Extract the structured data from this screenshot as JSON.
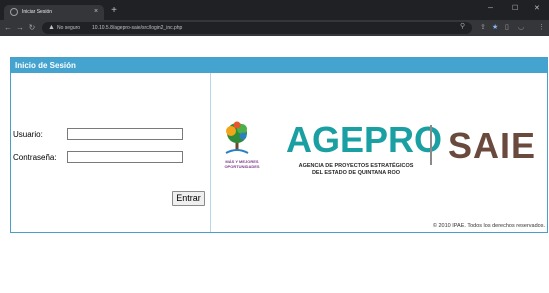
{
  "browser": {
    "tab_title": "Iniciar Sesión",
    "tab_close": "×",
    "new_tab": "+",
    "security_label": "No seguro",
    "url": "10.10.5.8/agepro-saie/src/login2_inc.php",
    "icons": [
      "back-icon",
      "forward-icon",
      "reload-icon",
      "warning-icon",
      "search-icon",
      "share-icon",
      "star-icon",
      "sidebar-icon",
      "profile-icon",
      "menu-icon"
    ]
  },
  "login": {
    "header": "Inicio de Sesión",
    "username_label": "Usuario:",
    "username_value": "",
    "password_label": "Contraseña:",
    "password_value": "",
    "submit_label": "Entrar"
  },
  "branding": {
    "tree_tagline": "MÁS Y MEJORES OPORTUNIDADES",
    "agepro_name": "AGEPRO",
    "agepro_line1": "AGENCIA DE PROYECTOS ESTRATÉGICOS",
    "agepro_line2": "DEL ESTADO DE QUINTANA ROO",
    "saie_name": "SAIE",
    "colors": {
      "agepro": "#1aa0a3",
      "saie": "#6b4a3e",
      "header": "#45a3cf",
      "tagline": "#7d3e8c"
    }
  },
  "footer": {
    "copyright": "© 2010 IPAE. Todos los derechos reservados."
  }
}
